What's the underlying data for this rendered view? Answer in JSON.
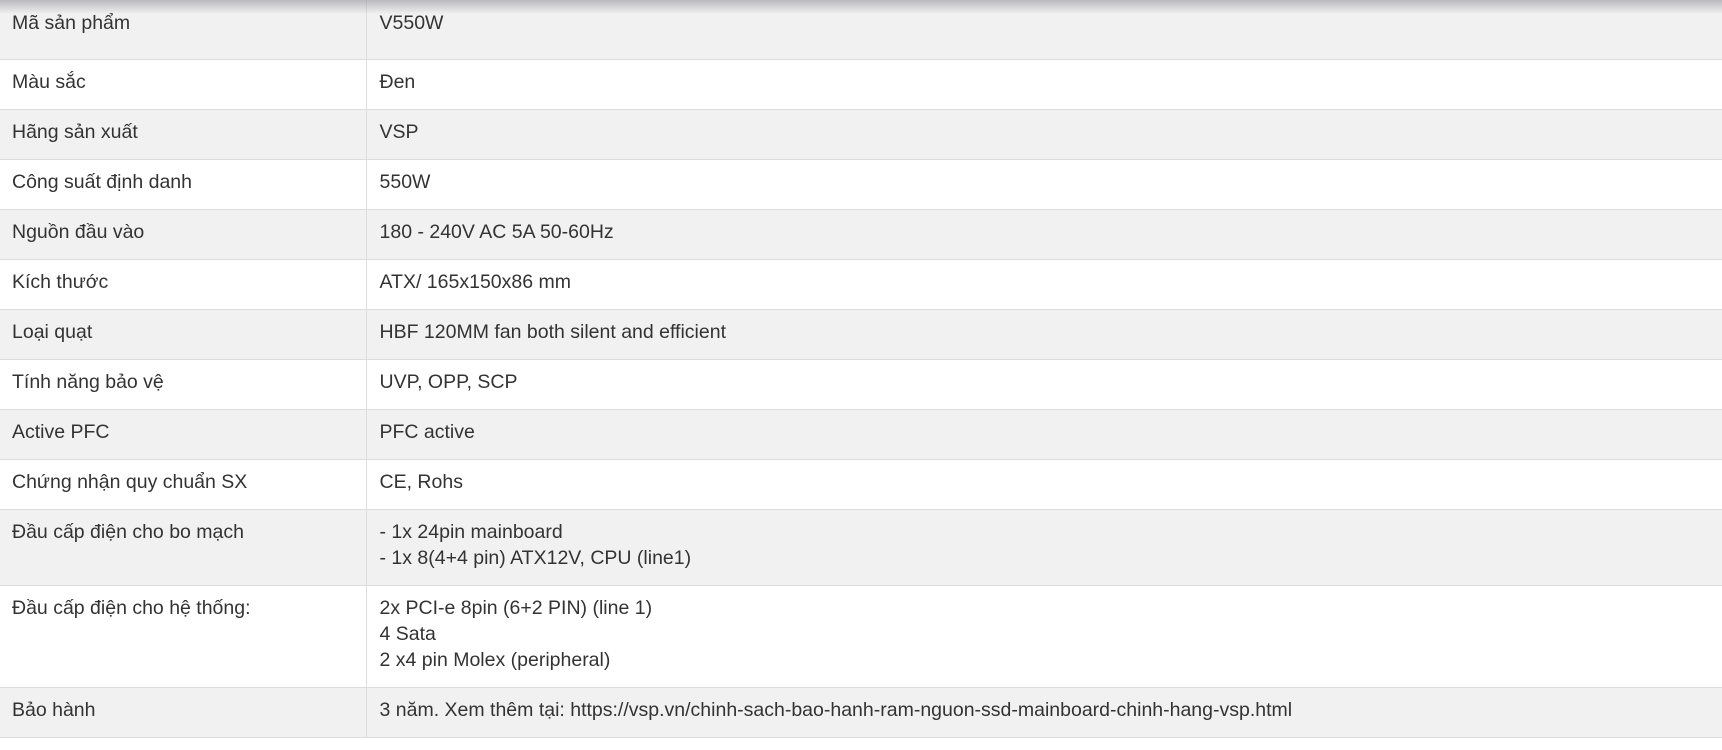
{
  "spec_table": {
    "rows": [
      {
        "label": "Mã sản phẩm",
        "value": "V550W"
      },
      {
        "label": "Màu sắc",
        "value": "Đen"
      },
      {
        "label": "Hãng sản xuất",
        "value": "VSP"
      },
      {
        "label": "Công suất định danh",
        "value": "550W"
      },
      {
        "label": "Nguồn đầu vào",
        "value": "180 - 240V AC 5A 50-60Hz"
      },
      {
        "label": "Kích thước",
        "value": "ATX/ 165x150x86 mm"
      },
      {
        "label": "Loại quạt",
        "value": "HBF 120MM fan both silent and efficient"
      },
      {
        "label": "Tính năng bảo vệ",
        "value": "UVP, OPP, SCP"
      },
      {
        "label": "Active PFC",
        "value": "PFC active"
      },
      {
        "label": "Chứng nhận quy chuẩn SX",
        "value": "CE, Rohs"
      },
      {
        "label": "Đầu cấp điện cho bo mạch",
        "value": "- 1x 24pin mainboard\n- 1x 8(4+4 pin) ATX12V, CPU (line1)"
      },
      {
        "label": "Đầu cấp điện cho hệ thống:",
        "value": "2x PCI-e 8pin (6+2 PIN) (line 1)\n4 Sata\n2 x4 pin Molex (peripheral)"
      },
      {
        "label": "Bảo hành",
        "value": "3 năm. Xem thêm tại: https://vsp.vn/chinh-sach-bao-hanh-ram-nguon-ssd-mainboard-chinh-hang-vsp.html"
      }
    ]
  }
}
